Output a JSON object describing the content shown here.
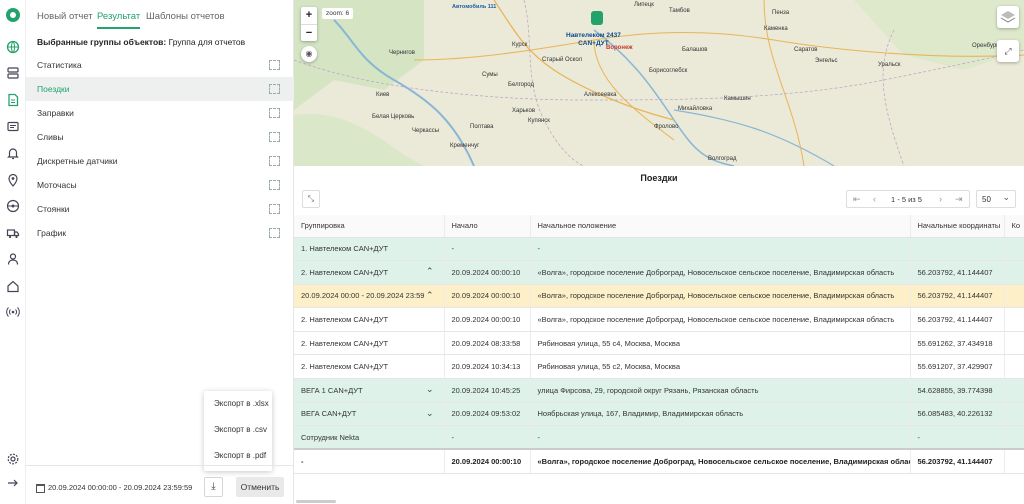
{
  "tabs": [
    "Новый отчет",
    "Результат",
    "Шаблоны отчетов"
  ],
  "selected_groups": {
    "label": "Выбранные группы объектов:",
    "value": "Группа для отчетов"
  },
  "report_groups": [
    "Статистика",
    "Поездки",
    "Заправки",
    "Сливы",
    "Дискретные датчики",
    "Моточасы",
    "Стоянки",
    "График"
  ],
  "active_group": "Поездки",
  "export_menu": [
    "Экспорт в .xlsx",
    "Экспорт в .csv",
    "Экспорт в .pdf"
  ],
  "bottom": {
    "date_range": "20.09.2024 00:00:00 - 20.09.2024 23:59:59",
    "cancel": "Отменить"
  },
  "map": {
    "zoom_label": "zoom: 6",
    "zoom_in": "+",
    "zoom_out": "−",
    "vehicle_label_line1": "Навтелеком 2437",
    "vehicle_label_line2": "CAN+ДУТ",
    "road_label": "Автомобиль 111",
    "cities": [
      "Чернигов",
      "Сумы",
      "Курск",
      "Киев",
      "Белая Церковь",
      "Черкассы",
      "Полтава",
      "Харьков",
      "Старый Оскол",
      "Белгород",
      "Кременчуг",
      "Купянск",
      "Воронеж",
      "Тамбов",
      "Балашов",
      "Саратов",
      "Борисоглебск",
      "Алексеевка",
      "Михайловка",
      "Волгоград",
      "Энгельс",
      "Уральск",
      "Оренбург",
      "Камышин",
      "Фролово",
      "Липецк",
      "Пенза",
      "Каменка"
    ]
  },
  "results": {
    "title": "Поездки",
    "pager_info": "1 - 5 из 5",
    "per_page": "50",
    "columns": [
      "Группировка",
      "Начало",
      "Начальное положение",
      "Начальные координаты",
      "Ко"
    ],
    "rows": [
      {
        "type": "green",
        "cells": [
          "1. Навтелеком CAN+ДУТ",
          "-",
          "-",
          "",
          ""
        ],
        "chev": ""
      },
      {
        "type": "green",
        "cells": [
          "2. Навтелеком CAN+ДУТ",
          "20.09.2024 00:00:10",
          "«Волга», городское поселение Доброград, Новосельское сельское поселение, Владимирская область",
          "56.203792, 41.144407",
          ""
        ],
        "chev": "⌃"
      },
      {
        "type": "yellow",
        "cells": [
          "20.09.2024 00:00 - 20.09.2024 23:59",
          "20.09.2024 00:00:10",
          "«Волга», городское поселение Доброград, Новосельское сельское поселение, Владимирская область",
          "56.203792, 41.144407",
          ""
        ],
        "chev": "⌃"
      },
      {
        "type": "white",
        "cells": [
          "2. Навтелеком CAN+ДУТ",
          "20.09.2024 00:00:10",
          "«Волга», городское поселение Доброград, Новосельское сельское поселение, Владимирская область",
          "56.203792, 41.144407",
          ""
        ],
        "chev": ""
      },
      {
        "type": "white",
        "cells": [
          "2. Навтелеком CAN+ДУТ",
          "20.09.2024 08:33:58",
          "Рябиновая улица, 55 с4, Москва, Москва",
          "55.691262, 37.434918",
          ""
        ],
        "chev": ""
      },
      {
        "type": "white",
        "cells": [
          "2. Навтелеком CAN+ДУТ",
          "20.09.2024 10:34:13",
          "Рябиновая улица, 55 с2, Москва, Москва",
          "55.691207, 37.429907",
          ""
        ],
        "chev": ""
      },
      {
        "type": "green",
        "cells": [
          "ВЕГА 1 CAN+ДУТ",
          "20.09.2024 10:45:25",
          "улица Фирсова, 29, городской округ Рязань, Рязанская область",
          "54.628855, 39.774398",
          ""
        ],
        "chev": "⌄"
      },
      {
        "type": "green",
        "cells": [
          "ВЕГА CAN+ДУТ",
          "20.09.2024 09:53:02",
          "Ноябрьская улица, 167, Владимир, Владимирская область",
          "56.085483, 40.226132",
          ""
        ],
        "chev": "⌄"
      },
      {
        "type": "green",
        "cells": [
          "Сотрудник Nekta",
          "-",
          "-",
          "-",
          ""
        ],
        "chev": ""
      }
    ],
    "total": [
      "-",
      "20.09.2024 00:00:10",
      "«Волга», городское поселение Доброград, Новосельское сельское поселение, Владимирская область",
      "56.203792, 41.144407",
      ""
    ]
  }
}
